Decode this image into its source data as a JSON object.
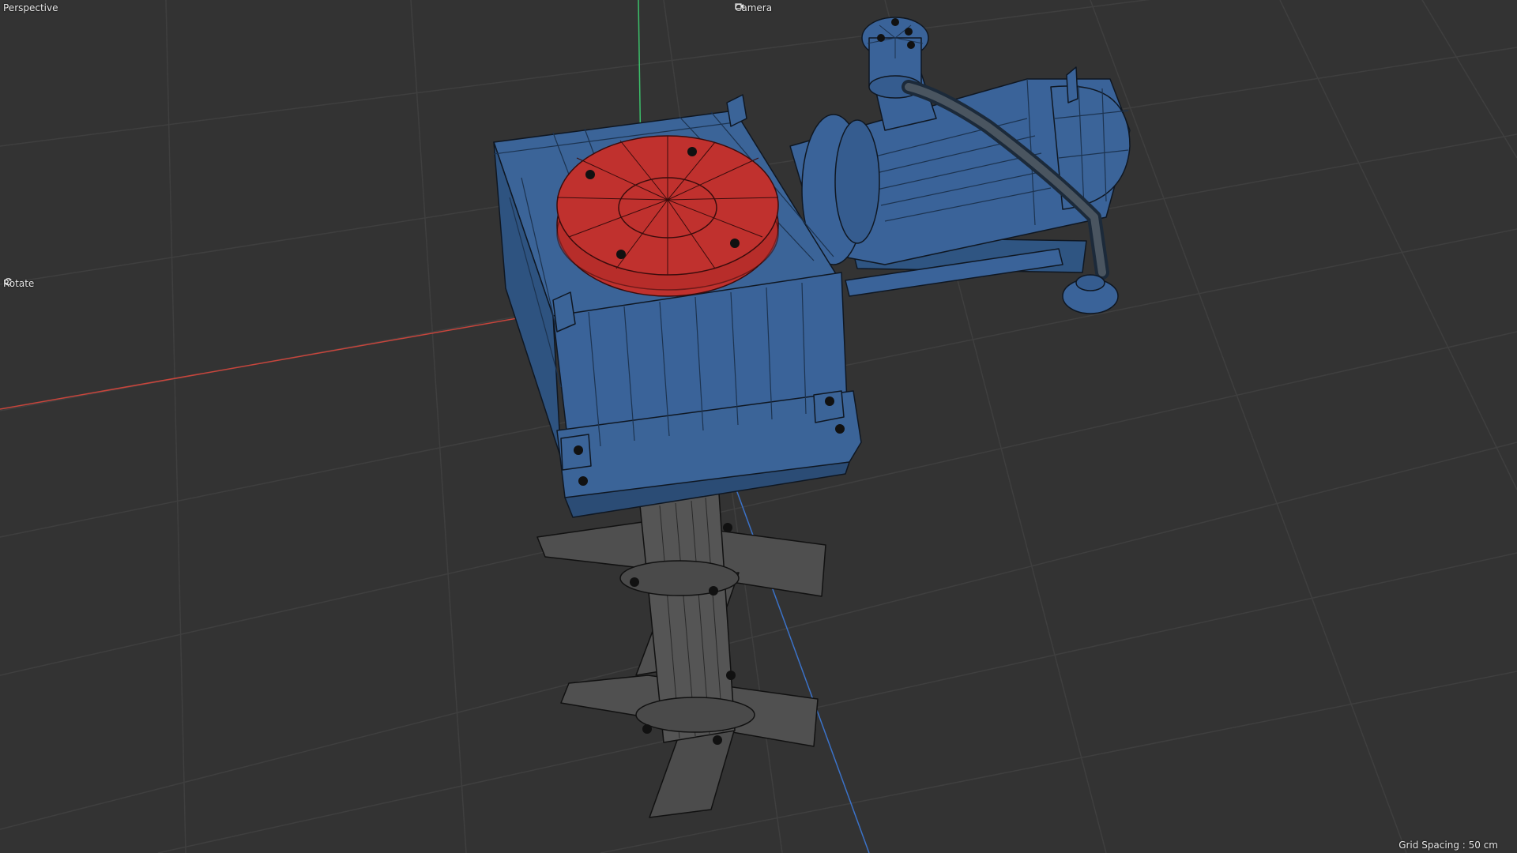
{
  "viewport": {
    "view_name": "Perspective",
    "camera_label": "Camera",
    "camera_icon": "camera-icon",
    "nav_mode": "Rotate",
    "nav_icon": "rotate-icon",
    "grid_spacing": "Grid Spacing : 50 cm"
  },
  "colors": {
    "background": "#333333",
    "grid": "#3f3f3f",
    "x_axis": "#c8453c",
    "y_axis": "#3cc06a",
    "z_axis": "#3b72c8",
    "selected_object": "#3a6399",
    "selected_polygons": "#c0312e",
    "unselected_object": "#555555",
    "wire": "#101418"
  }
}
